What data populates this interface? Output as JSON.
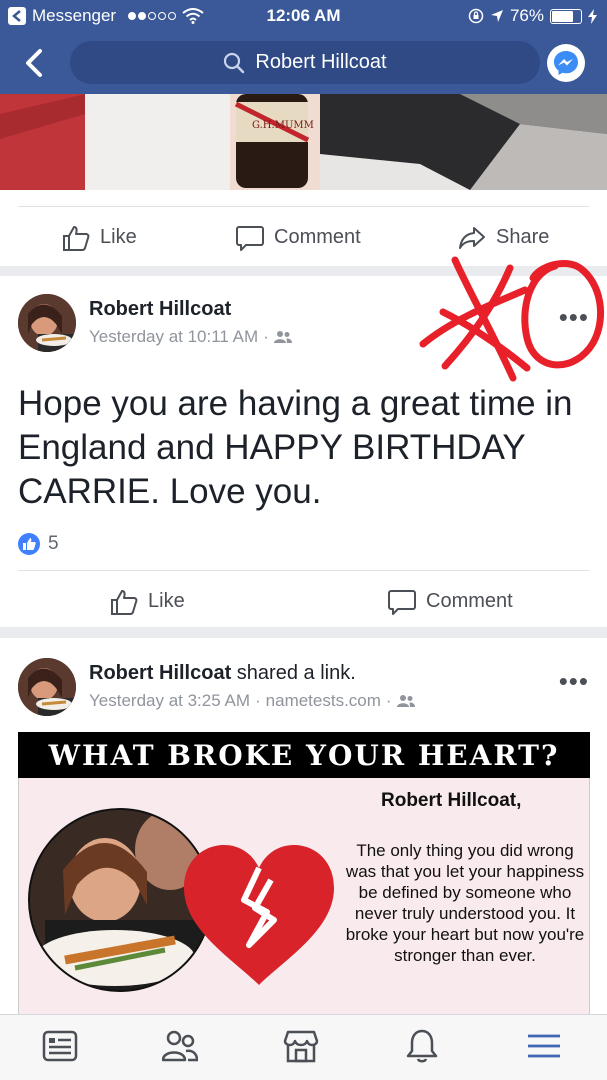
{
  "status_bar": {
    "back_app": "Messenger",
    "time": "12:06 AM",
    "battery_percent": "76%",
    "battery_level": 0.76
  },
  "nav": {
    "search_text": "Robert Hillcoat"
  },
  "top_post_actions": {
    "like": "Like",
    "comment": "Comment",
    "share": "Share"
  },
  "post1": {
    "author": "Robert Hillcoat",
    "time": "Yesterday at 10:11 AM",
    "separator": "·",
    "text": "Hope you are having a great time in England and HAPPY BIRTHDAY CARRIE.  Love you.",
    "like_count": "5",
    "actions": {
      "like": "Like",
      "comment": "Comment"
    },
    "annotation_color": "#e8202a"
  },
  "post2": {
    "author": "Robert Hillcoat",
    "action": " shared a link.",
    "time": "Yesterday at 3:25 AM",
    "separator": "·",
    "source": "nametests.com",
    "preview": {
      "title": "WHAT BROKE YOUR HEART?",
      "name": "Robert Hillcoat,",
      "message": "The only thing you did wrong was that you let your happiness be defined by someone who never truly understood you. It broke your heart but now you're stronger than ever."
    }
  },
  "colors": {
    "brand": "#3b5998",
    "like_blue": "#4080ff",
    "tab_active": "#4267b2",
    "heart_red": "#d8232a"
  },
  "tabs": [
    "news-feed-icon",
    "friends-icon",
    "marketplace-icon",
    "notifications-icon",
    "menu-icon"
  ]
}
